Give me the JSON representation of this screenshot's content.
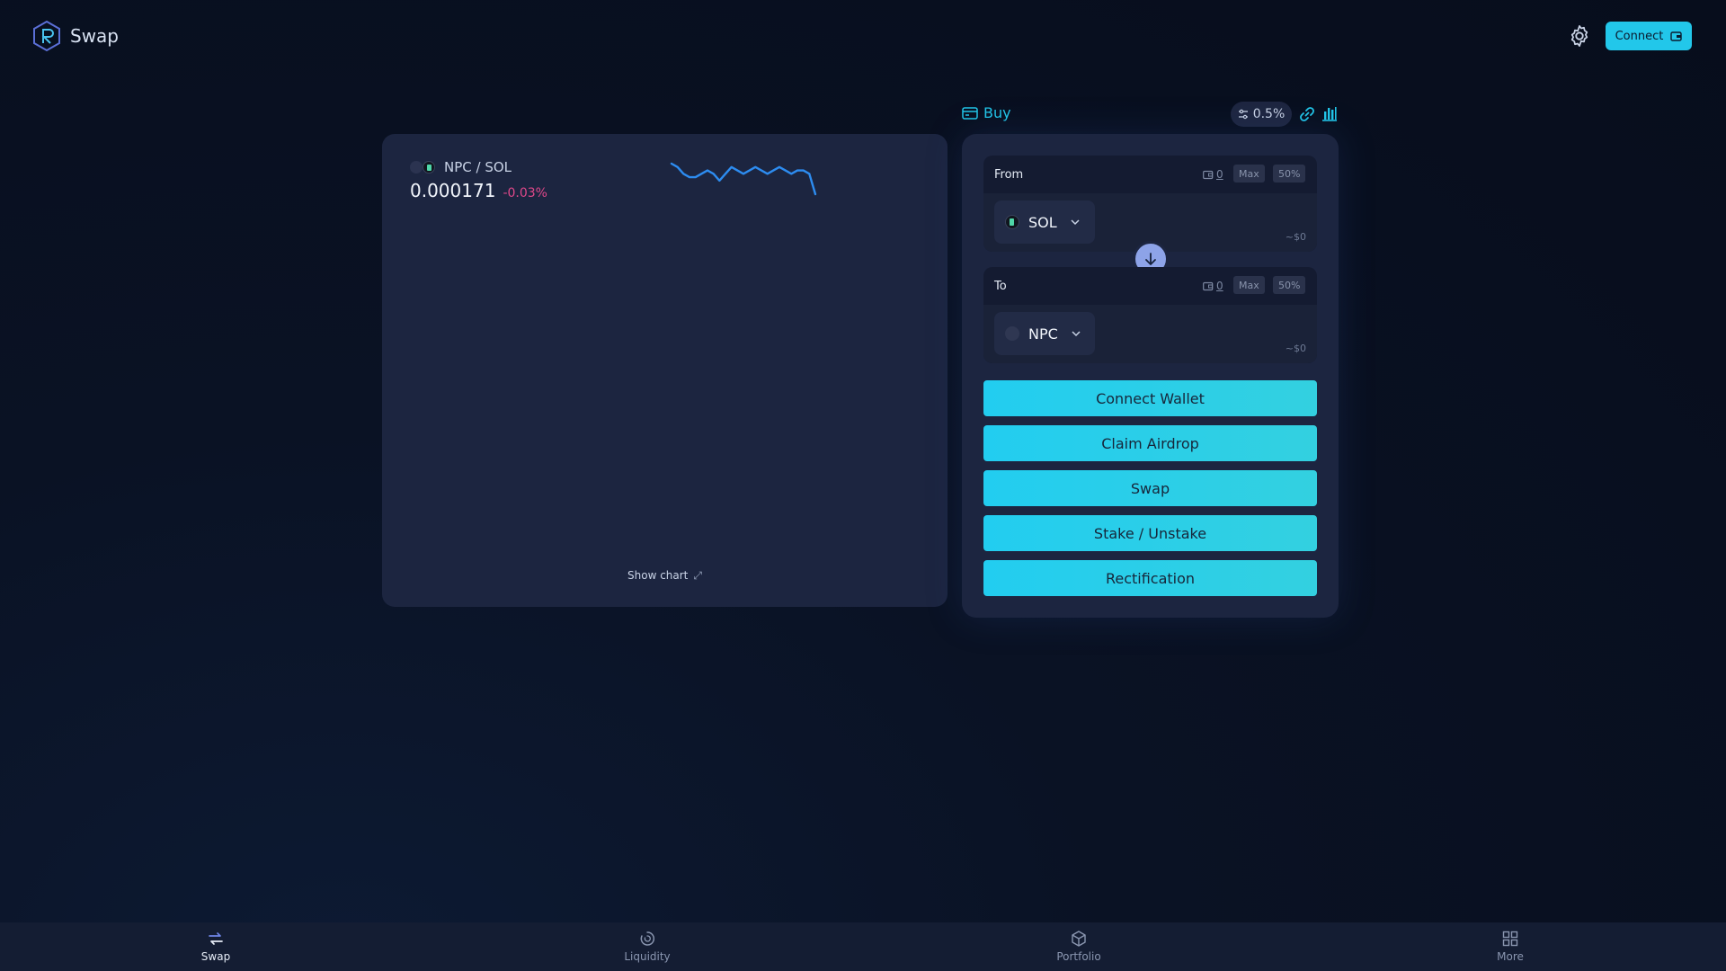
{
  "header": {
    "logo_text": "Swap",
    "connect_label": "Connect"
  },
  "chart_panel": {
    "pair_label": "NPC / SOL",
    "price": "0.000171",
    "change": "-0.03%",
    "show_chart_label": "Show chart"
  },
  "swap_header": {
    "buy_label": "Buy",
    "slippage": "0.5%"
  },
  "swap": {
    "from": {
      "label": "From",
      "balance": "0",
      "max_label": "Max",
      "half_label": "50%",
      "token": "SOL",
      "usd_value": "~$0"
    },
    "to": {
      "label": "To",
      "balance": "0",
      "max_label": "Max",
      "half_label": "50%",
      "token": "NPC",
      "usd_value": "~$0"
    },
    "actions": [
      "Connect Wallet",
      "Claim Airdrop",
      "Swap",
      "Stake / Unstake",
      "Rectification"
    ]
  },
  "bottom_nav": {
    "items": [
      {
        "label": "Swap",
        "icon": "swap-icon",
        "active": true
      },
      {
        "label": "Liquidity",
        "icon": "liquidity-icon",
        "active": false
      },
      {
        "label": "Portfolio",
        "icon": "portfolio-icon",
        "active": false
      },
      {
        "label": "More",
        "icon": "grid-icon",
        "active": false
      }
    ]
  },
  "colors": {
    "accent": "#22c7ea",
    "negative": "#e0488a",
    "panel": "#1c2540",
    "sparkline": "#2d8cf0"
  },
  "sparkline": {
    "values": [
      10,
      9,
      7,
      6,
      6,
      7,
      8,
      7,
      5,
      7,
      9,
      8,
      7,
      8,
      9,
      8,
      7,
      8,
      9,
      8,
      7,
      8,
      8,
      7,
      1
    ]
  }
}
